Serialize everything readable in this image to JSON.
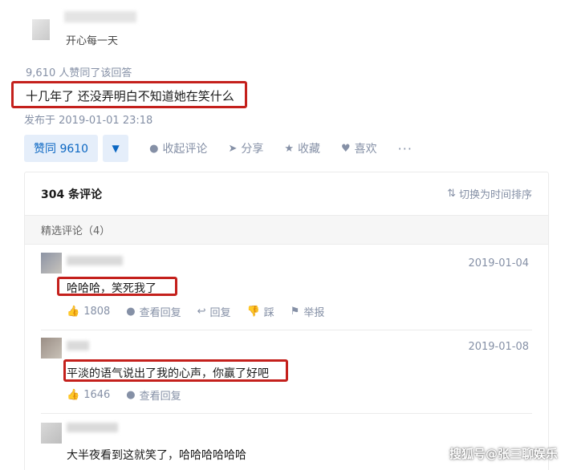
{
  "author": {
    "headline": "开心每一天"
  },
  "answer": {
    "vote_summary": "9,610 人赞同了该回答",
    "text": "十几年了 还没弄明白不知道她在笑什么",
    "publish_time": "发布于 2019-01-01 23:18"
  },
  "actions": {
    "upvote_label": "赞同 9610",
    "downvote_symbol": "▼",
    "collapse_comments": "收起评论",
    "share": "分享",
    "collect": "收藏",
    "like": "喜欢",
    "more": "···"
  },
  "comments_panel": {
    "title": "304 条评论",
    "sort_toggle": "切换为时间排序",
    "featured_label": "精选评论（4）",
    "comments": [
      {
        "date": "2019-01-04",
        "text": "哈哈哈，笑死我了",
        "likes": "1808",
        "view_replies": "查看回复",
        "reply": "回复",
        "dislike": "踩",
        "report": "举报"
      },
      {
        "date": "2019-01-08",
        "text": "平淡的语气说出了我的心声，你赢了好吧",
        "likes": "1646",
        "view_replies": "查看回复"
      },
      {
        "text": "大半夜看到这就笑了，哈哈哈哈哈哈"
      }
    ]
  },
  "watermark": "搜狐号@张三聊娱乐",
  "colors": {
    "highlight": "#c4201c",
    "upvote_bg": "#e5eefa",
    "upvote_fg": "#0a66c2",
    "meta_gray": "#8590a6"
  }
}
